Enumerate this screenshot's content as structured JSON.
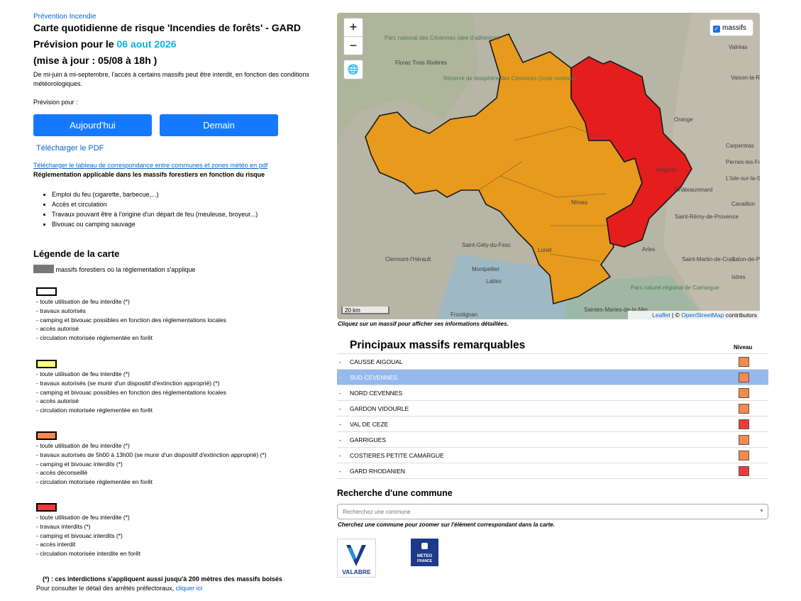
{
  "header": {
    "kicker": "Prévention Incendie",
    "title": "Carte quotidienne de risque 'Incendies de forêts' - GARD",
    "forecast_prefix": "Prévision pour le",
    "forecast_date": "06 aout 2026",
    "update": "(mise à jour : 05/08 à 18h )",
    "intro": "De mi-juin à mi-septembre, l'accès à certains massifs peut être interdit, en fonction des conditions météorologiques.",
    "prevision_label": "Prévision pour :"
  },
  "buttons": {
    "today": "Aujourd'hui",
    "tomorrow": "Demain"
  },
  "links": {
    "pdf": "Télécharger le PDF",
    "table": "Télécharger le tableau de correspondance entre communes et zones météo en pdf",
    "click_here": "cliquer ici"
  },
  "regulation": {
    "title": "Réglementation applicable dans les massifs forestiers en fonction du risque",
    "items": [
      "Emploi du feu (cigarette, barbecue,...)",
      "Accès et circulation",
      "Travaux pouvant être à l'origine d'un départ de feu (meuleuse, broyeur...)",
      "Bivouac ou camping sauvage"
    ]
  },
  "legend": {
    "title": "Légende de la carte",
    "forest_label": "massifs forestiers où la réglementation s'applique",
    "levels": [
      {
        "color": "#ffffff",
        "lines": [
          "- toute utilisation de feu interdite (*)",
          "- travaux autorisés",
          "- camping et bivouac possibles en fonction des réglementations locales",
          "- accès autorisé",
          "- circulation motorisée réglementée en forêt"
        ]
      },
      {
        "color": "#ffff7f",
        "lines": [
          "- toute utilisation de feu interdite (*)",
          "- travaux autorisés (se munir d'un dispositif d'extinction approprié) (*)",
          "- camping et bivouac possibles en fonction des réglementations locales",
          "- accès autorisé",
          "- circulation motorisée réglementée en forêt"
        ]
      },
      {
        "color": "#f6894d",
        "lines": [
          "- toute utilisation de feu interdite (*)",
          "- travaux autorisés de 5h00 à 13h00 (se munir d'un dispositif d'extinction approprié) (*)",
          "- camping et bivouac interdits (*)",
          "- accès déconseillé",
          "- circulation motorisée réglementée en forêt"
        ]
      },
      {
        "color": "#ee3b3b",
        "lines": [
          "- toute utilisation de feu interdite (*)",
          "- travaux interdits (*)",
          "- camping et bivouac interdits (*)",
          "- accès interdit",
          "- circulation motorisée interdite en forêt"
        ]
      }
    ],
    "note": "(*) : ces interdictions s'appliquent aussi jusqu'à 200 mètres des massifs boisés",
    "consult": "Pour consulter le détail des arrêtés préfectoraux,"
  },
  "map": {
    "layer_label": "massifs",
    "scale": "20 km",
    "attribution_leaflet": "Leaflet",
    "attribution_sep": " | © ",
    "attribution_osm": "OpenStreetMap",
    "attribution_tail": " contributors",
    "hint": "Cliquez sur un massif pour afficher ses informations détaillées.",
    "colors": {
      "orange": "#e89a1d",
      "red": "#e41d1d"
    },
    "labels": [
      "Parc national des Cévennes (aire d'adhésion)",
      "Florac Trois Rivières",
      "Réserve de biosphère des Cévennes (zone centrale)",
      "Valréas",
      "Vaison-la-Romaine",
      "Orange",
      "Carpentras",
      "Pernes-les-Fontaines",
      "L'Isle-sur-la-Sorgue",
      "Châteaurenard",
      "Cavaillon",
      "Saint-Rémy-de-Provence",
      "Saint-Gély-du-Fesc",
      "Clermont-l'Hérault",
      "Montpellier",
      "Lattes",
      "Frontignan",
      "Arles",
      "Saint-Martin-de-Crau",
      "Salon-de-Provence",
      "Istres",
      "Parc naturel régional de Camargue",
      "Saintes-Maries-de-la-Mer",
      "Lunel",
      "Nîmes",
      "Avignon"
    ]
  },
  "massifs": {
    "title": "Principaux massifs remarquables",
    "level_header": "Niveau",
    "rows": [
      {
        "name": "CAUSSE AIGOUAL",
        "color": "#f6894d",
        "selected": false
      },
      {
        "name": "SUD CEVENNES",
        "color": "#f6894d",
        "selected": true
      },
      {
        "name": "NORD CEVENNES",
        "color": "#f6894d",
        "selected": false
      },
      {
        "name": "GARDON VIDOURLE",
        "color": "#f6894d",
        "selected": false
      },
      {
        "name": "VAL DE CEZE",
        "color": "#ee3b3b",
        "selected": false
      },
      {
        "name": "GARRIGUES",
        "color": "#f6894d",
        "selected": false
      },
      {
        "name": "COSTIERES PETITE CAMARGUE",
        "color": "#f6894d",
        "selected": false
      },
      {
        "name": "GARD RHODANIEN",
        "color": "#ee3b3b",
        "selected": false
      }
    ]
  },
  "search": {
    "title": "Recherche d'une commune",
    "placeholder": "Recherchez une commune",
    "hint": "Cherchez une commune pour zoomer sur l'élément correspondant dans la carte."
  },
  "logos": {
    "valabre": "VALABRE",
    "meteo1": "METEO",
    "meteo2": "FRANCE"
  }
}
